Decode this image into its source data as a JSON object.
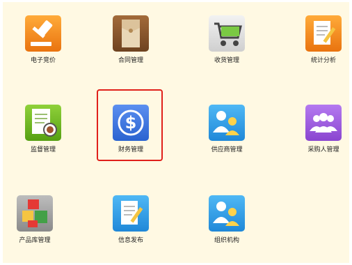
{
  "modules": [
    {
      "label": "电子竞价",
      "icon": "gavel-icon",
      "color": "#f08a1c"
    },
    {
      "label": "合同管理",
      "icon": "contract-folder-icon",
      "color": "#8a5a2f"
    },
    {
      "label": "收货管理",
      "icon": "shopping-cart-icon",
      "color": "#d8d8d8"
    },
    {
      "label": "统计分析",
      "icon": "document-edit-icon",
      "color": "#f08a1c"
    },
    {
      "label": "监督管理",
      "icon": "inspection-doc-icon",
      "color": "#67b020"
    },
    {
      "label": "财务管理",
      "icon": "dollar-icon",
      "color": "#3a7de6"
    },
    {
      "label": "供应商管理",
      "icon": "supplier-people-icon",
      "color": "#2d9ae0"
    },
    {
      "label": "采购人管理",
      "icon": "buyer-people-icon",
      "color": "#9a55d8"
    },
    {
      "label": "产品库管理",
      "icon": "product-boxes-icon",
      "color": "#9a9a9a"
    },
    {
      "label": "信息发布",
      "icon": "info-publish-icon",
      "color": "#2d9ae0"
    },
    {
      "label": "组织机构",
      "icon": "organization-people-icon",
      "color": "#2d9ae0"
    }
  ],
  "selected": "财务管理"
}
